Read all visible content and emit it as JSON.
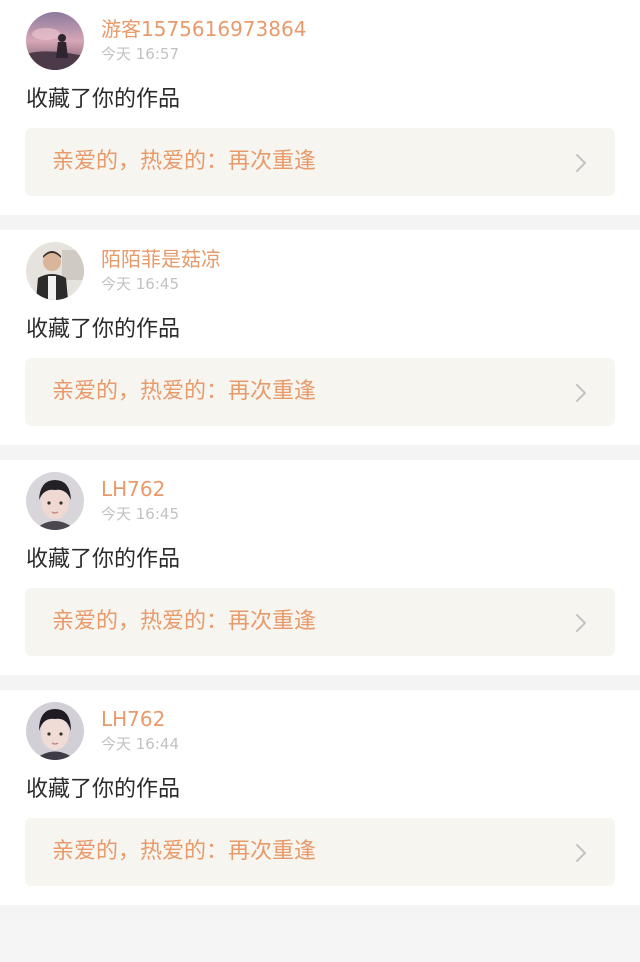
{
  "colors": {
    "accent": "#e89a6b",
    "time_text": "#c2c2c2",
    "body_text": "#2b2b2b",
    "card_link_bg": "#f6f5ef",
    "separator": "#f4f4f4"
  },
  "notifications": [
    {
      "user": "游客1575616973864",
      "time": "今天 16:57",
      "action": "收藏了你的作品",
      "work_title": "亲爱的，热爱的：再次重逢",
      "avatar_icon": "avatar-pink-sky-icon"
    },
    {
      "user": "陌陌菲是菇凉",
      "time": "今天 16:45",
      "action": "收藏了你的作品",
      "work_title": "亲爱的，热爱的：再次重逢",
      "avatar_icon": "avatar-person-photo-icon"
    },
    {
      "user": "LH762",
      "time": "今天 16:45",
      "action": "收藏了你的作品",
      "work_title": "亲爱的，热爱的：再次重逢",
      "avatar_icon": "avatar-portrait-icon"
    },
    {
      "user": "LH762",
      "time": "今天 16:44",
      "action": "收藏了你的作品",
      "work_title": "亲爱的，热爱的：再次重逢",
      "avatar_icon": "avatar-portrait-icon"
    }
  ]
}
